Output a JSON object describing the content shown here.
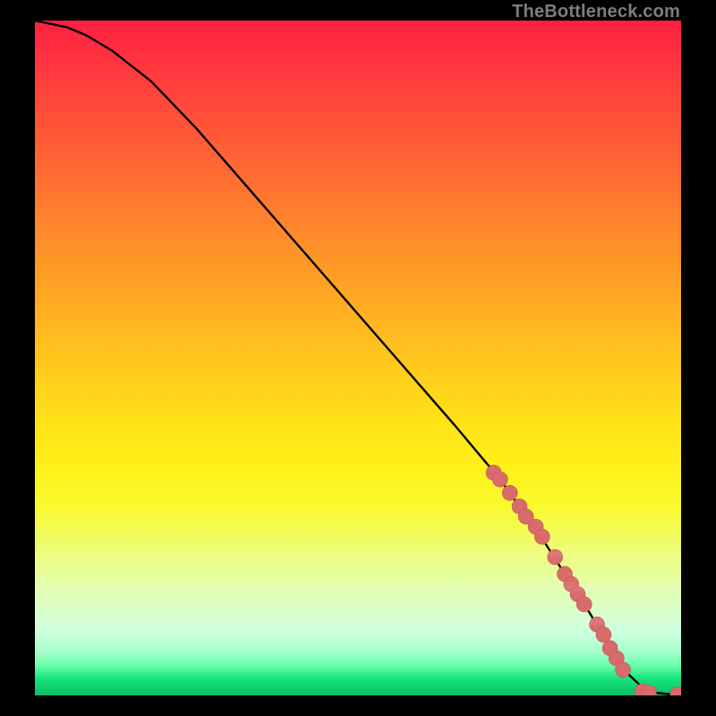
{
  "watermark": "TheBottleneck.com",
  "colors": {
    "curve": "#000000",
    "marker_fill": "#d96b6b",
    "marker_stroke": "#c25555",
    "gradient_top": "#ff1f42",
    "gradient_mid": "#ffe317",
    "gradient_bottom": "#0fbd67"
  },
  "chart_data": {
    "type": "line",
    "title": "",
    "xlabel": "",
    "ylabel": "",
    "xlim": [
      0,
      100
    ],
    "ylim": [
      0,
      100
    ],
    "grid": false,
    "curve_note": "Values are estimated from pixel positions; axes are unlabeled in the source image.",
    "curve": {
      "x": [
        0,
        2,
        5,
        8,
        12,
        18,
        25,
        35,
        45,
        55,
        65,
        72,
        78,
        82,
        86,
        88,
        90,
        92,
        94,
        96,
        98,
        100
      ],
      "y": [
        100,
        99.6,
        99,
        97.8,
        95.5,
        91,
        84,
        73,
        62,
        51,
        40,
        32,
        24,
        18,
        12,
        8.5,
        5.5,
        3,
        1.2,
        0.4,
        0.2,
        0.15
      ]
    },
    "series": [
      {
        "name": "markers",
        "style": "points",
        "x": [
          71,
          72,
          73.5,
          75,
          76,
          77.5,
          78.5,
          80.5,
          82,
          83,
          84,
          85,
          87,
          88,
          89,
          90,
          91,
          94,
          95,
          99.5
        ],
        "y": [
          33,
          32,
          30,
          28,
          26.5,
          25,
          23.5,
          20.5,
          18,
          16.5,
          15,
          13.5,
          10.5,
          9,
          7,
          5.5,
          3.8,
          0.6,
          0.4,
          0.15
        ]
      }
    ],
    "legend": {
      "visible": false
    }
  }
}
